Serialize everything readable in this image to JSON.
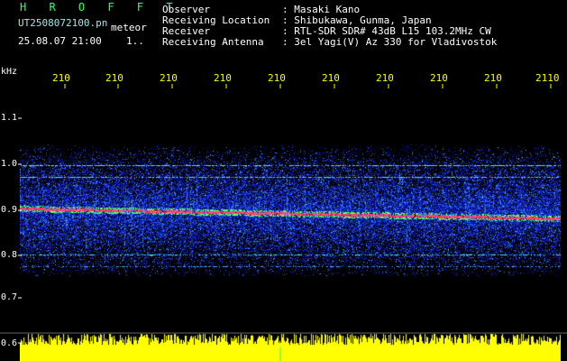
{
  "header": {
    "station": "H R O F F T",
    "filename": "UT2508072100.pn",
    "mode": "meteor",
    "datetime": "25.08.07 21:00",
    "frame": "1.."
  },
  "info": {
    "labels": [
      "Observer",
      "Receiving Location",
      "Receiver",
      "Receiving Antenna"
    ],
    "values": [
      ": Masaki Kano",
      ": Shibukawa, Gunma, Japan",
      ": RTL-SDR SDR# 43dB L15 103.2MHz CW",
      ": 3el Yagi(V) Az 330 for Vladivostok"
    ]
  },
  "axis": {
    "unit": "kHz",
    "y_ticks": [
      "1.1",
      "1.0",
      "0.9",
      "0.8",
      "0.7",
      "0.6"
    ],
    "x_ticks": [
      "210",
      "210",
      "210",
      "210",
      "210",
      "210",
      "210",
      "210",
      "210",
      "2110"
    ]
  },
  "colors": {
    "background": "#000000",
    "noise_blue": "#1e3cff",
    "echo_red": "#ff3355",
    "echo_green": "#33ff88",
    "waveform_yellow": "#ffff00",
    "tick_yellow": "#ffff00",
    "label_cyan": "#9de8e8"
  }
}
